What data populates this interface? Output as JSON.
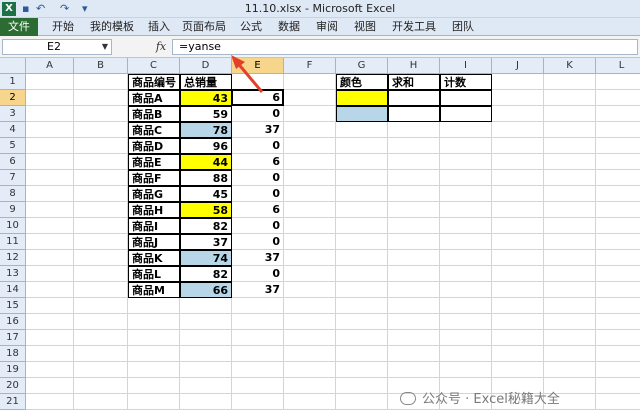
{
  "titlebar": {
    "app_icon": "X",
    "save_icon": "save-icon",
    "undo_icon": "↶",
    "redo_icon": "↷",
    "customize_icon": "▾",
    "title": "11.10.xlsx - Microsoft Excel"
  },
  "ribbon": {
    "file_tab": "文件",
    "tabs": [
      "开始",
      "我的模板",
      "插入",
      "页面布局",
      "公式",
      "数据",
      "审阅",
      "视图",
      "开发工具",
      "团队"
    ]
  },
  "formula_bar": {
    "name_box": "E2",
    "fx": "fx",
    "formula": "=yanse"
  },
  "sheet": {
    "columns": [
      "A",
      "B",
      "C",
      "D",
      "E",
      "F",
      "G",
      "H",
      "I",
      "J",
      "K",
      "L"
    ],
    "rows": [
      "1",
      "2",
      "3",
      "4",
      "5",
      "6",
      "7",
      "8",
      "9",
      "10",
      "11",
      "12",
      "13",
      "14",
      "15",
      "16",
      "17",
      "18",
      "19",
      "20",
      "21"
    ],
    "selected_cell": "E2",
    "header_c": "商品编号",
    "header_d": "总销量",
    "products": [
      "商品A",
      "商品B",
      "商品C",
      "商品D",
      "商品E",
      "商品F",
      "商品G",
      "商品H",
      "商品I",
      "商品J",
      "商品K",
      "商品L",
      "商品M"
    ],
    "sales": [
      "43",
      "59",
      "78",
      "96",
      "44",
      "88",
      "45",
      "58",
      "82",
      "37",
      "74",
      "82",
      "66"
    ],
    "sales_fill": [
      "yellow",
      "none",
      "blue",
      "none",
      "yellow",
      "none",
      "none",
      "yellow",
      "none",
      "none",
      "blue",
      "none",
      "blue"
    ],
    "e_values": [
      "6",
      "0",
      "37",
      "0",
      "6",
      "0",
      "0",
      "6",
      "0",
      "0",
      "37",
      "0",
      "37"
    ],
    "summary": {
      "header_g": "颜色",
      "header_h": "求和",
      "header_i": "计数",
      "g2_fill": "yellow",
      "g3_fill": "blue"
    }
  },
  "colors": {
    "yellow": "#ffff00",
    "blue": "#b7d7e8",
    "arrow": "#e2402a",
    "file_tab": "#2b6c32"
  },
  "watermark": "公众号 · Excel秘籍大全"
}
